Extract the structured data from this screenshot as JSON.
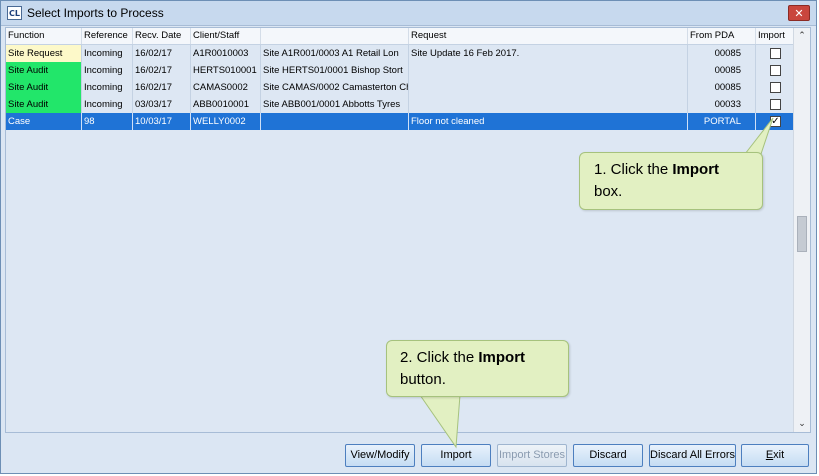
{
  "window": {
    "title": "Select Imports to Process",
    "icon": "CL",
    "close_glyph": "✕"
  },
  "columns": [
    "Function",
    "Reference",
    "Recv. Date",
    "Client/Staff",
    "",
    "Request",
    "From PDA",
    "Import"
  ],
  "rows": [
    {
      "function": "Site Request",
      "func_color": "#fdf9c9",
      "reference": "Incoming",
      "date": "16/02/17",
      "client": "A1R0010003",
      "site": "Site A1R001/0003 A1 Retail Lon",
      "request": "Site Update 16 Feb 2017.",
      "pda": "00085",
      "checked": false,
      "selected": false
    },
    {
      "function": "Site Audit",
      "func_color": "#22e66a",
      "reference": "Incoming",
      "date": "16/02/17",
      "client": "HERTS010001",
      "site": "Site HERTS01/0001 Bishop Stort",
      "request": "",
      "pda": "00085",
      "checked": false,
      "selected": false
    },
    {
      "function": "Site Audit",
      "func_color": "#22e66a",
      "reference": "Incoming",
      "date": "16/02/17",
      "client": "CAMAS0002",
      "site": "Site CAMAS/0002 Camasterton Ch",
      "request": "",
      "pda": "00085",
      "checked": false,
      "selected": false
    },
    {
      "function": "Site Audit",
      "func_color": "#22e66a",
      "reference": "Incoming",
      "date": "03/03/17",
      "client": "ABB0010001",
      "site": "Site ABB001/0001 Abbotts Tyres",
      "request": "",
      "pda": "00033",
      "checked": false,
      "selected": false
    },
    {
      "function": "Case",
      "func_color": "",
      "reference": "98",
      "date": "10/03/17",
      "client": "WELLY0002",
      "site": "",
      "request": "Floor not cleaned",
      "pda": "PORTAL",
      "checked": true,
      "selected": true
    }
  ],
  "callouts": {
    "one": {
      "prefix": "1. Click the ",
      "bold": "Import",
      "suffix": " box."
    },
    "two": {
      "prefix": "2. Click the ",
      "bold": "Import",
      "suffix": " button."
    }
  },
  "buttons": {
    "view_modify": "View/Modify",
    "import": "Import",
    "import_stores": "Import Stores",
    "discard": "Discard",
    "discard_all_errors": "Discard All Errors",
    "exit": "Exit"
  },
  "scrollbar": {
    "up_glyph": "⌃",
    "down_glyph": "⌄"
  },
  "colors": {
    "selected_row": "#1f73d6",
    "callout_bg": "#e2f0c2",
    "site_audit": "#22e66a",
    "site_request": "#fdf9c9"
  }
}
